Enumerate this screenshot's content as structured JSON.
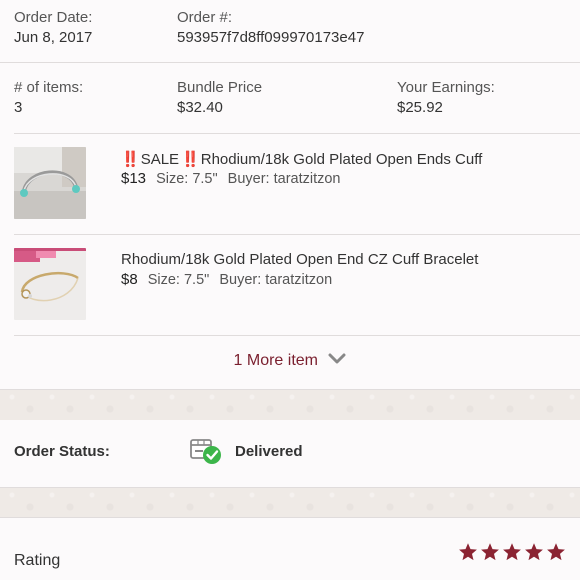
{
  "order": {
    "date_label": "Order Date:",
    "date_value": "Jun 8, 2017",
    "number_label": "Order #:",
    "number_value": "593957f7d8ff099970173e47"
  },
  "summary": {
    "items_label": "# of items:",
    "items_value": "3",
    "bundle_label": "Bundle Price",
    "bundle_value": "$32.40",
    "earnings_label": "Your Earnings:",
    "earnings_value": "$25.92"
  },
  "items": [
    {
      "sale_prefix": "‼️",
      "sale_text": "SALE",
      "sale_suffix": "‼️",
      "title": "Rhodium/18k Gold Plated Open Ends Cuff",
      "price": "$13",
      "size": "Size: 7.5\"",
      "buyer": "Buyer: taratzitzon"
    },
    {
      "title": "Rhodium/18k Gold Plated Open End CZ Cuff Bracelet",
      "price": "$8",
      "size": "Size: 7.5\"",
      "buyer": "Buyer: taratzitzon"
    }
  ],
  "more_items": "1 More item",
  "status": {
    "label": "Order Status:",
    "value": "Delivered",
    "icon": "package-delivered-icon"
  },
  "rating": {
    "label": "Rating",
    "stars": 5,
    "max": 5,
    "color": "#8b2332"
  },
  "colors": {
    "accent": "#7a1f2e",
    "check": "#3cb54a"
  }
}
